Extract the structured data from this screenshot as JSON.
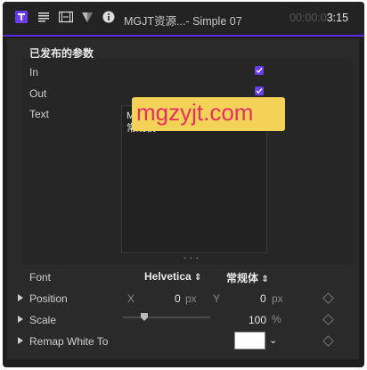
{
  "toolbar": {
    "title": "MGJT资源...- Simple 07",
    "timecode_dim": "00:00:0",
    "timecode_bright": "3:15",
    "icons": [
      "text-inspector-icon",
      "paragraph-icon",
      "film-icon",
      "filter-icon",
      "info-icon"
    ],
    "accent": "#5a2fe0"
  },
  "section": {
    "title": "已发布的参数"
  },
  "params": {
    "in": {
      "label": "In",
      "checked": true
    },
    "out": {
      "label": "Out",
      "checked": true
    },
    "text": {
      "label": "Text",
      "value_line1": "M",
      "value_line2": "常规模"
    }
  },
  "font": {
    "label": "Font",
    "family": "Helvetica",
    "style": "常规体"
  },
  "position": {
    "label": "Position",
    "x_label": "X",
    "x_value": "0",
    "x_unit": "px",
    "y_label": "Y",
    "y_value": "0",
    "y_unit": "px"
  },
  "scale": {
    "label": "Scale",
    "value": "100",
    "unit": "%"
  },
  "remap": {
    "label": "Remap White To",
    "color": "#ffffff"
  },
  "watermark": {
    "text": "mgzyjt.com"
  }
}
